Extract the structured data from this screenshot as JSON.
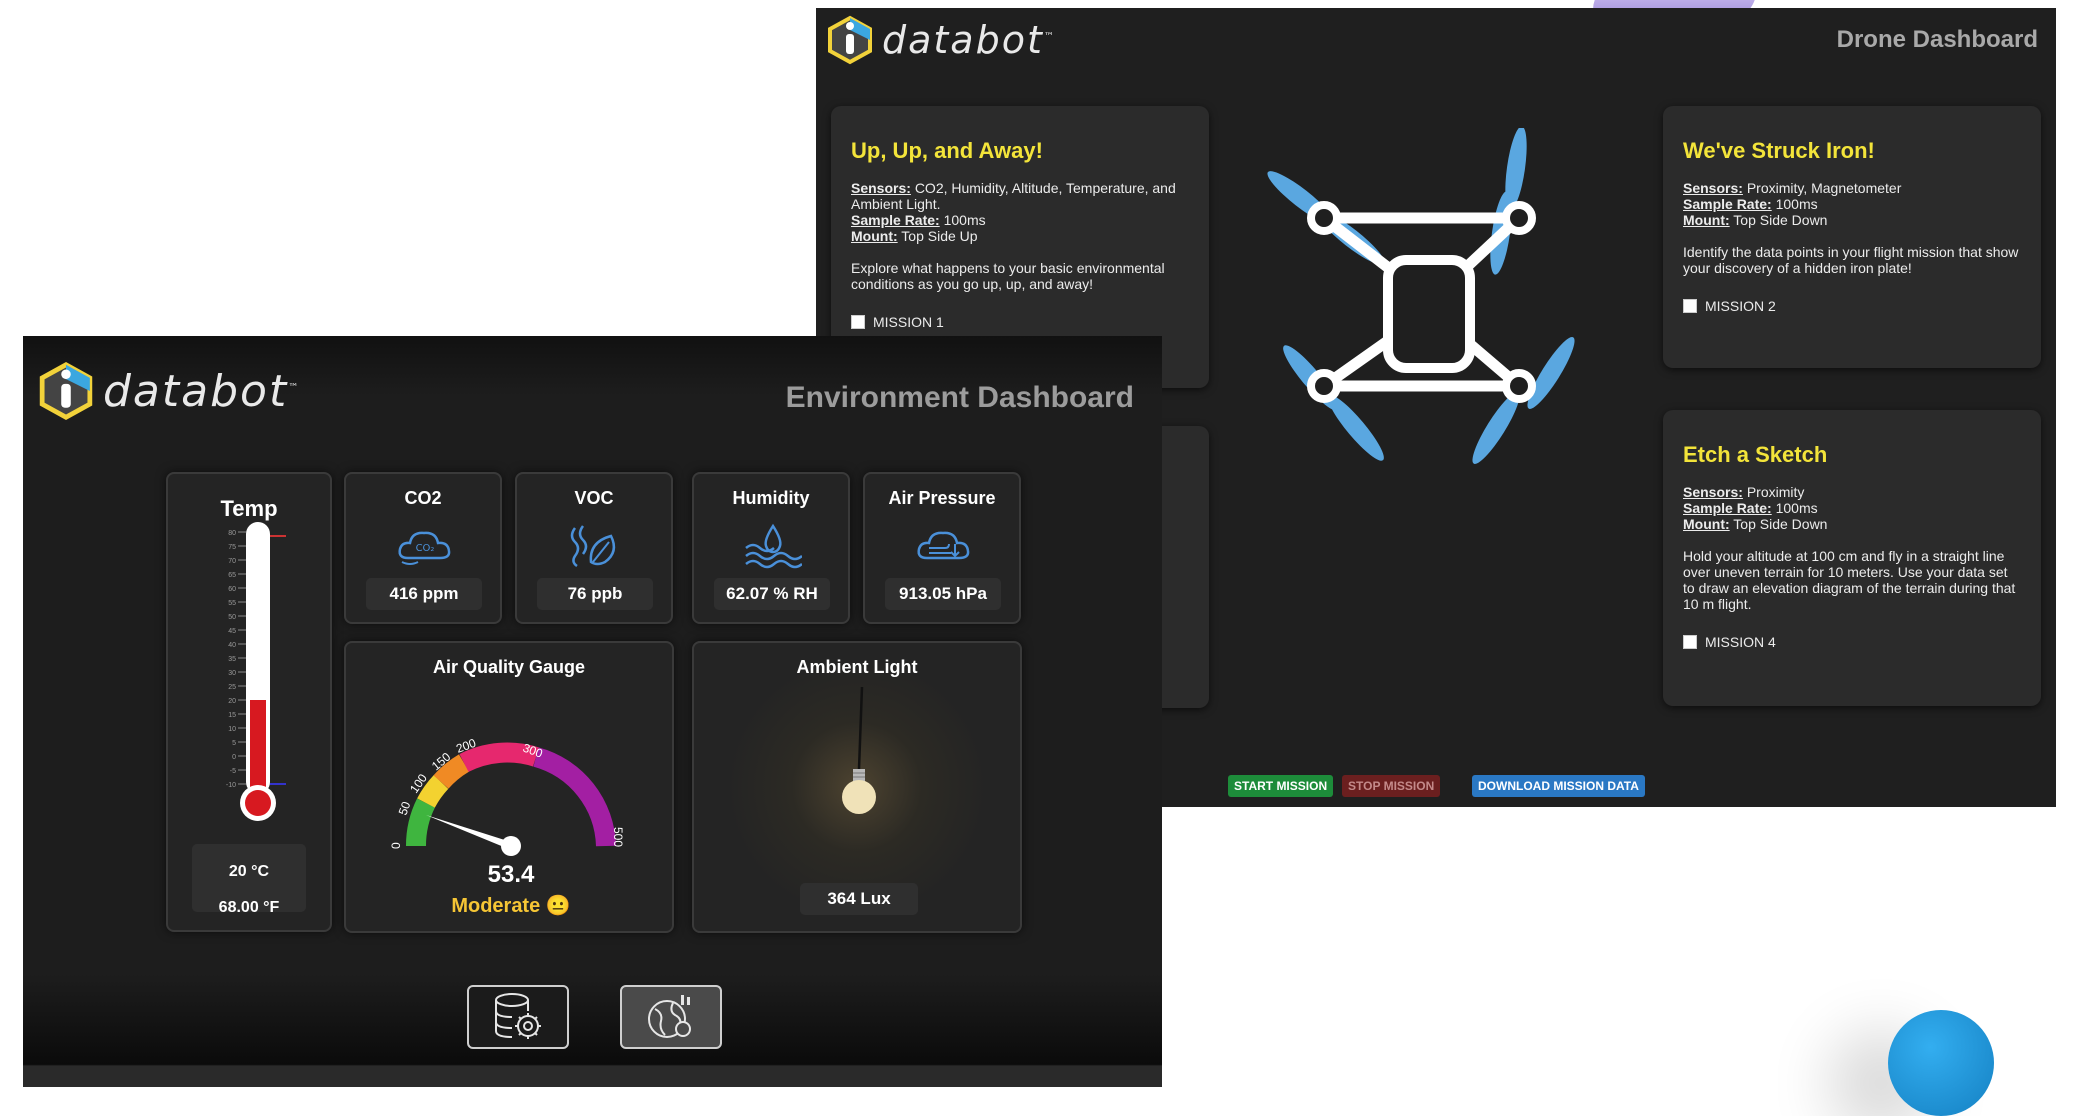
{
  "drone": {
    "logo_text": "databot",
    "logo_tm": "™",
    "title": "Drone Dashboard",
    "missions": [
      {
        "title": "Up, Up, and Away!",
        "sensors_label": "Sensors:",
        "sensors": "CO2, Humidity, Altitude, Temperature, and Ambient Light.",
        "rate_label": "Sample Rate:",
        "rate": "100ms",
        "mount_label": "Mount:",
        "mount": "Top Side Up",
        "description": "Explore what happens to your basic environmental conditions as you go up, up, and away!",
        "checkbox_label": "MISSION 1"
      },
      {
        "title": "We've Struck Iron!",
        "sensors_label": "Sensors:",
        "sensors": "Proximity, Magnetometer",
        "rate_label": "Sample Rate:",
        "rate": "100ms",
        "mount_label": "Mount:",
        "mount": "Top Side Down",
        "description": "Identify the data points in your flight mission that show your discovery of a hidden iron plate!",
        "checkbox_label": "MISSION 2"
      },
      {
        "title": "Etch a Sketch",
        "sensors_label": "Sensors:",
        "sensors": "Proximity",
        "rate_label": "Sample Rate:",
        "rate": "100ms",
        "mount_label": "Mount:",
        "mount": "Top Side Down",
        "description": "Hold your altitude at 100 cm and fly in a straight line over uneven terrain for 10 meters. Use your data set to draw an elevation diagram of the terrain during that 10 m flight.",
        "checkbox_label": "MISSION 4"
      }
    ],
    "buttons": {
      "start": "START MISSION",
      "stop": "STOP MISSION",
      "download": "DOWNLOAD MISSION DATA"
    }
  },
  "env": {
    "logo_text": "databot",
    "logo_tm": "™",
    "title": "Environment Dashboard",
    "temp": {
      "title": "Temp",
      "celsius": "20 °C",
      "fahrenheit": "68.00 °F",
      "fill_celsius": 20,
      "scale_min": -10,
      "scale_max": 80
    },
    "sensors": [
      {
        "title": "CO2",
        "value": "416 ppm",
        "icon": "co2-cloud-icon"
      },
      {
        "title": "VOC",
        "value": "76 ppb",
        "icon": "voc-leaf-icon"
      },
      {
        "title": "Humidity",
        "value": "62.07 % RH",
        "icon": "humidity-icon"
      },
      {
        "title": "Air Pressure",
        "value": "913.05 hPa",
        "icon": "air-pressure-icon"
      }
    ],
    "gauge": {
      "title": "Air Quality Gauge",
      "value": "53.4",
      "status": "Moderate 😐",
      "ticks": [
        "0",
        "50",
        "100",
        "150",
        "200",
        "300",
        "500"
      ],
      "needle_value": 53.4
    },
    "light": {
      "title": "Ambient Light",
      "value": "364 Lux"
    },
    "footer": {
      "data_button_icon": "database-gear-icon",
      "env_button_icon": "globe-gear-icon"
    }
  },
  "colors": {
    "accent_yellow": "#f3e43a",
    "start_green": "#1d8c3a",
    "stop_red": "#6b1f1f",
    "download_blue": "#2a78c4",
    "drone_blue": "#5aa7e0"
  }
}
